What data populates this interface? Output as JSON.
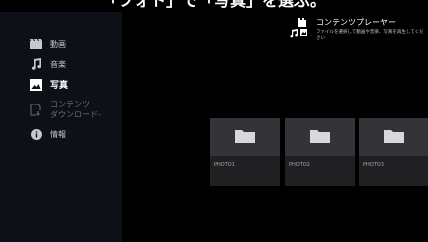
{
  "banner": {
    "text": "「フォト」で「写真」を選ぶ。"
  },
  "sidebar": {
    "items": [
      {
        "label": "動画",
        "icon": "movie-icon",
        "state": "normal"
      },
      {
        "label": "音楽",
        "icon": "music-note-icon",
        "state": "normal"
      },
      {
        "label": "写真",
        "icon": "photo-icon",
        "state": "active"
      },
      {
        "label_lines": [
          "コンテンツ",
          "ダウンロード-"
        ],
        "icon": "content-download-icon",
        "state": "disabled"
      },
      {
        "label": "情報",
        "icon": "info-icon",
        "state": "normal"
      }
    ]
  },
  "app": {
    "title": "コンテンツプレーヤー",
    "description": "ファイルを選択して動画や音楽、写真を再生してください",
    "icon": "content-player-icon"
  },
  "tiles": [
    {
      "label": "PHOTO1",
      "icon": "folder-icon"
    },
    {
      "label": "PHOTO2",
      "icon": "folder-icon"
    },
    {
      "label": "PHOTO3",
      "icon": "folder-icon"
    }
  ],
  "colors": {
    "background": "#000000",
    "sidebar": "#0e1018",
    "tile_thumb": "#343438",
    "tile_caption": "#202022",
    "text_primary": "#ffffff",
    "text_secondary": "#c8c8cc",
    "text_disabled": "#6c6e76"
  }
}
